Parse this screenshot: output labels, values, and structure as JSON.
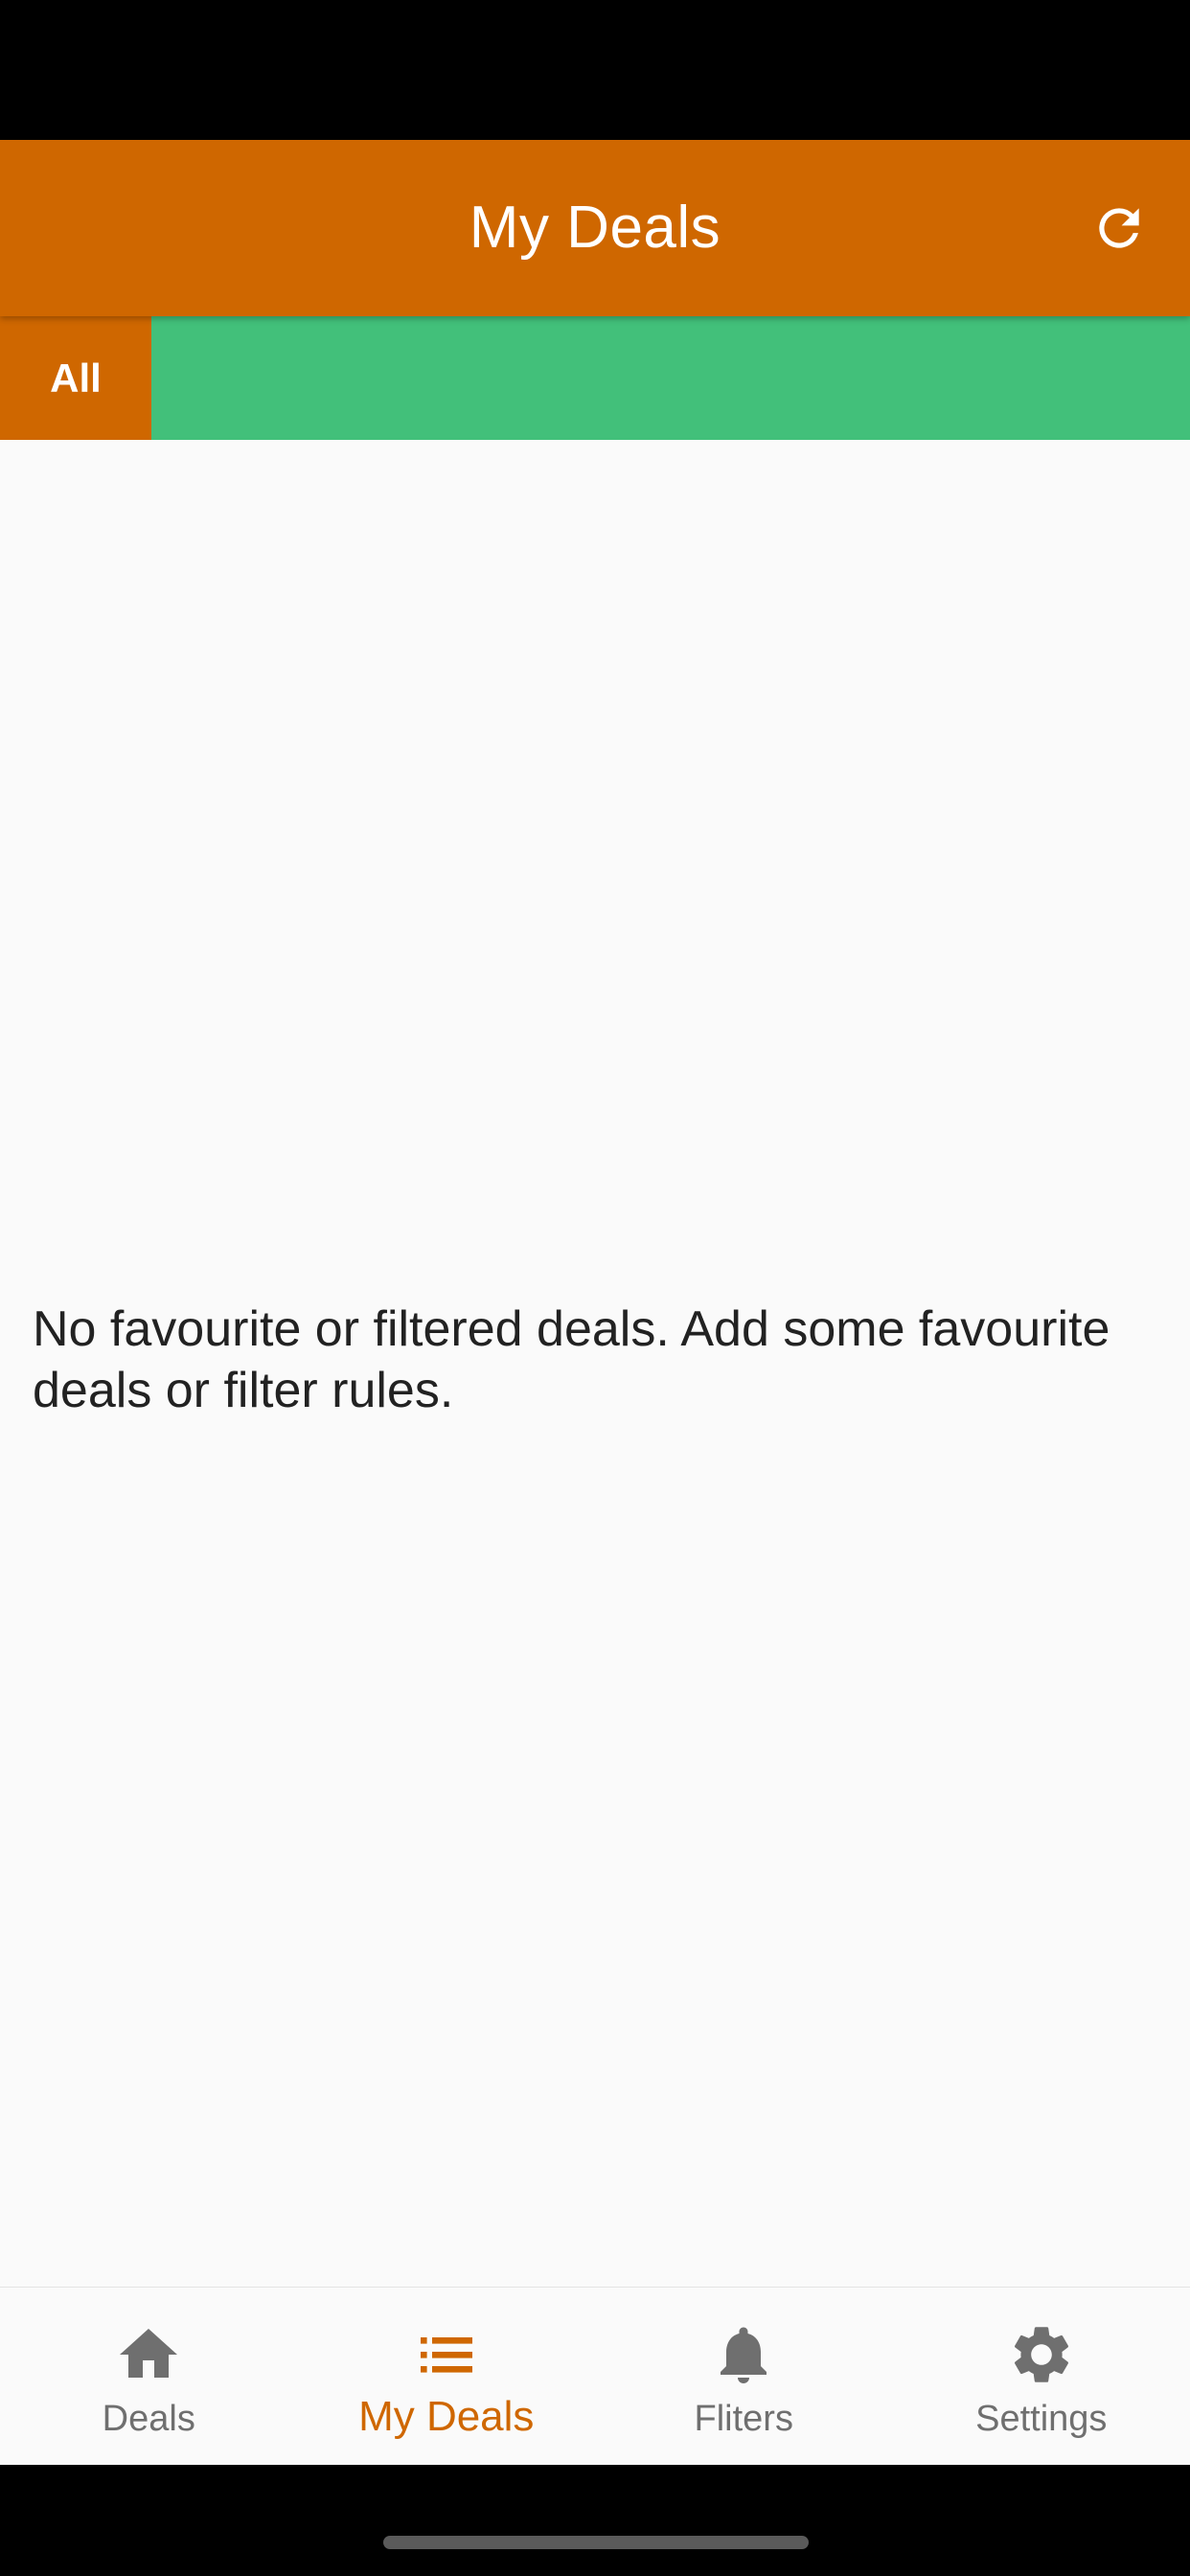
{
  "header": {
    "title": "My Deals",
    "refresh_icon": "refresh-icon"
  },
  "tabs": [
    {
      "label": "All",
      "selected": true
    }
  ],
  "main": {
    "empty_message": "No favourite or filtered deals. Add some favourite deals or filter rules."
  },
  "bottom_nav": {
    "items": [
      {
        "label": "Deals",
        "icon": "home-icon",
        "active": false
      },
      {
        "label": "My Deals",
        "icon": "list-icon",
        "active": true
      },
      {
        "label": "Fliters",
        "icon": "bell-icon",
        "active": false
      },
      {
        "label": "Settings",
        "icon": "gear-icon",
        "active": false
      }
    ]
  },
  "colors": {
    "primary": "#cf6700",
    "tab_strip": "#42c07a",
    "background": "#fafafa",
    "inactive_nav": "#6f6f6f"
  }
}
